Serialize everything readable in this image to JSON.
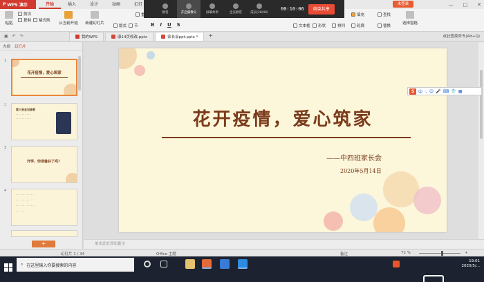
{
  "titlebar": {
    "app_name": "WPS 演示",
    "tabs": [
      "开始",
      "插入",
      "设计",
      "动画",
      "幻灯"
    ],
    "active_tab": "开始",
    "login_label": "未登录"
  },
  "ribbon": {
    "paste": "粘贴",
    "cut": "剪切",
    "copy": "复制",
    "format_painter": "格式刷",
    "from_current": "从当前开始",
    "new_slide": "新建幻灯片",
    "layout": "版式",
    "section": "节",
    "reset": "重置",
    "text_box": "文本框",
    "shape": "形状",
    "arrange": "排列",
    "outline": "轮廓",
    "fill": "填充",
    "find": "查找",
    "replace": "替换",
    "select_pane": "选择窗格"
  },
  "recording": {
    "mute": "静音",
    "camera": "开启摄像头",
    "screen_share": "屏幕共享",
    "all_mute": "全员静音",
    "members": "成员(28/48)",
    "time": "00:10:06",
    "end_share": "结束共享"
  },
  "doc_tabs": [
    {
      "label": "我的WPS",
      "active": false
    },
    {
      "label": "康14页修改.pptx",
      "active": false
    },
    {
      "label": "家长会ppt.pptx *",
      "active": true
    }
  ],
  "cmd_search": "点此查找命令(Alt+Q)",
  "left_panel": {
    "tab_outline": "大纲",
    "tab_slides": "幻灯片",
    "thumbs": [
      {
        "num": "1",
        "title": "花开疫情，爱心筑家"
      },
      {
        "num": "2",
        "title": "家人安全记录表"
      },
      {
        "num": "3",
        "title": "开学，你准备好了吗？"
      },
      {
        "num": "4",
        "title": ""
      }
    ],
    "add_label": "+"
  },
  "slide": {
    "title": "花开疫情，爱心筑家",
    "subtitle": "——中四班家长会",
    "date": "2020年5月14日"
  },
  "ime": {
    "logo": "S",
    "items": [
      "中",
      "·,",
      "☺",
      "🎤",
      "⌨",
      "👕",
      "▦"
    ]
  },
  "notes_placeholder": "单击此处添加备注",
  "statusbar": {
    "slide_count": "幻灯片 1 / 34",
    "theme": "Office 主题",
    "notes": "备注",
    "zoom": "72 %",
    "zoom_fraction": 0.55
  },
  "taskbar": {
    "search_placeholder": "在这里输入你要搜索的内容",
    "time": "19:01",
    "date": "2020/5/..."
  }
}
